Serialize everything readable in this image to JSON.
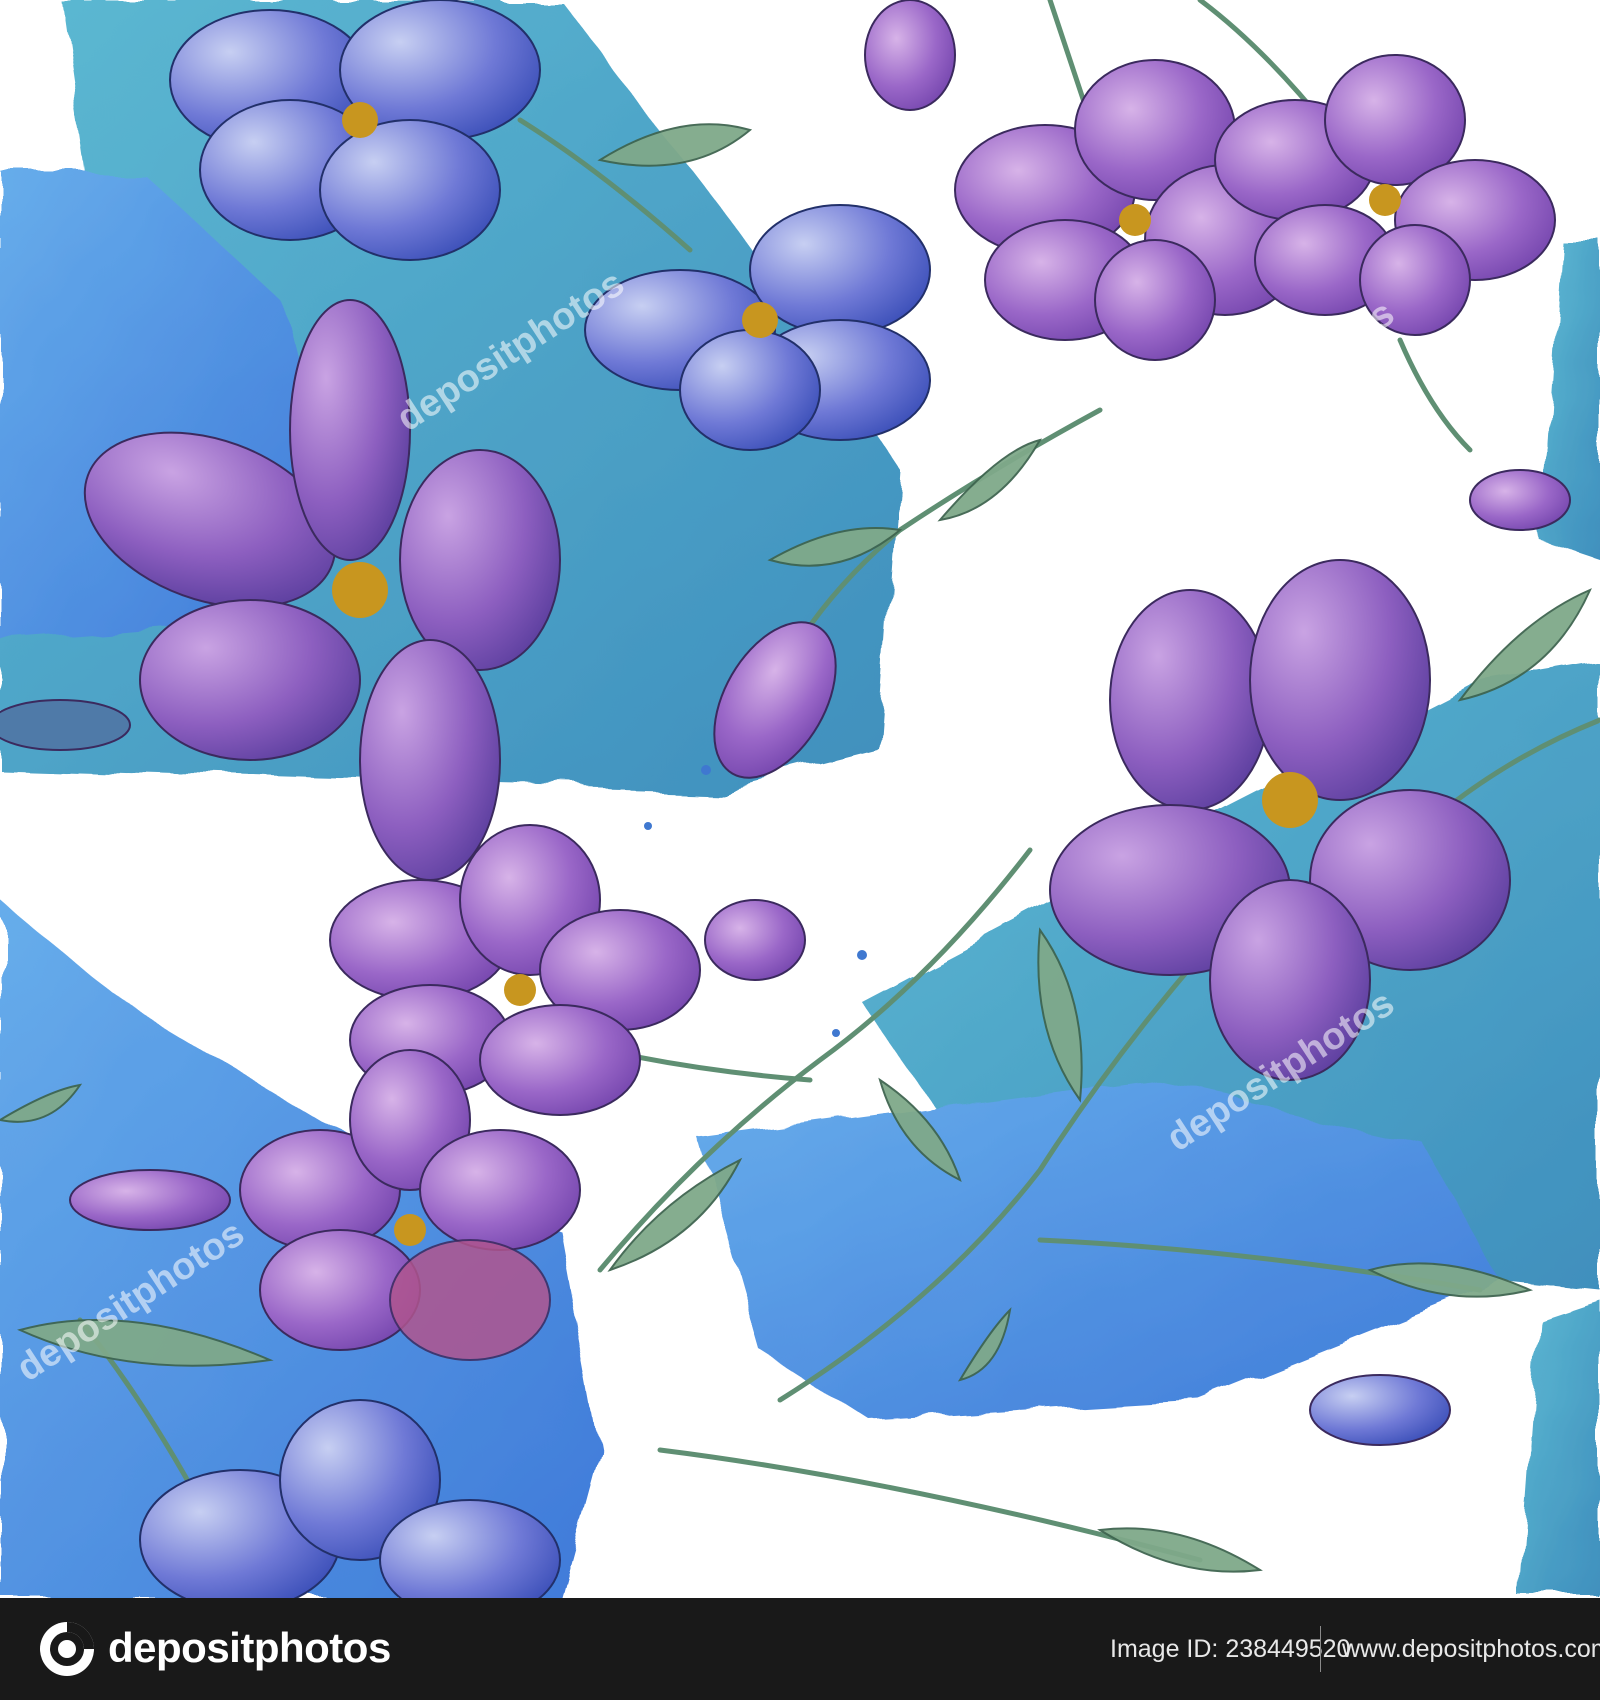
{
  "image": {
    "palette": {
      "background": "#ffffff",
      "blue_wash": "#3f8fe0",
      "teal_wash": "#48a7c4",
      "violet": "#8d5fc0",
      "lavender": "#b58ad6",
      "leaf": "#5f8f73",
      "stamen": "#c8961f",
      "footer": "#191919"
    },
    "subjects": [
      "purple-flax-flower",
      "blue-flax-flower",
      "flower-bud",
      "green-leaf",
      "watercolor-brush-stroke"
    ]
  },
  "watermark": {
    "text": "depositphotos"
  },
  "footer": {
    "logo_icon": "camera-aperture-icon",
    "brand": "depositphotos",
    "image_id": "Image ID: 238449520",
    "url": "www.depositphotos.com"
  }
}
